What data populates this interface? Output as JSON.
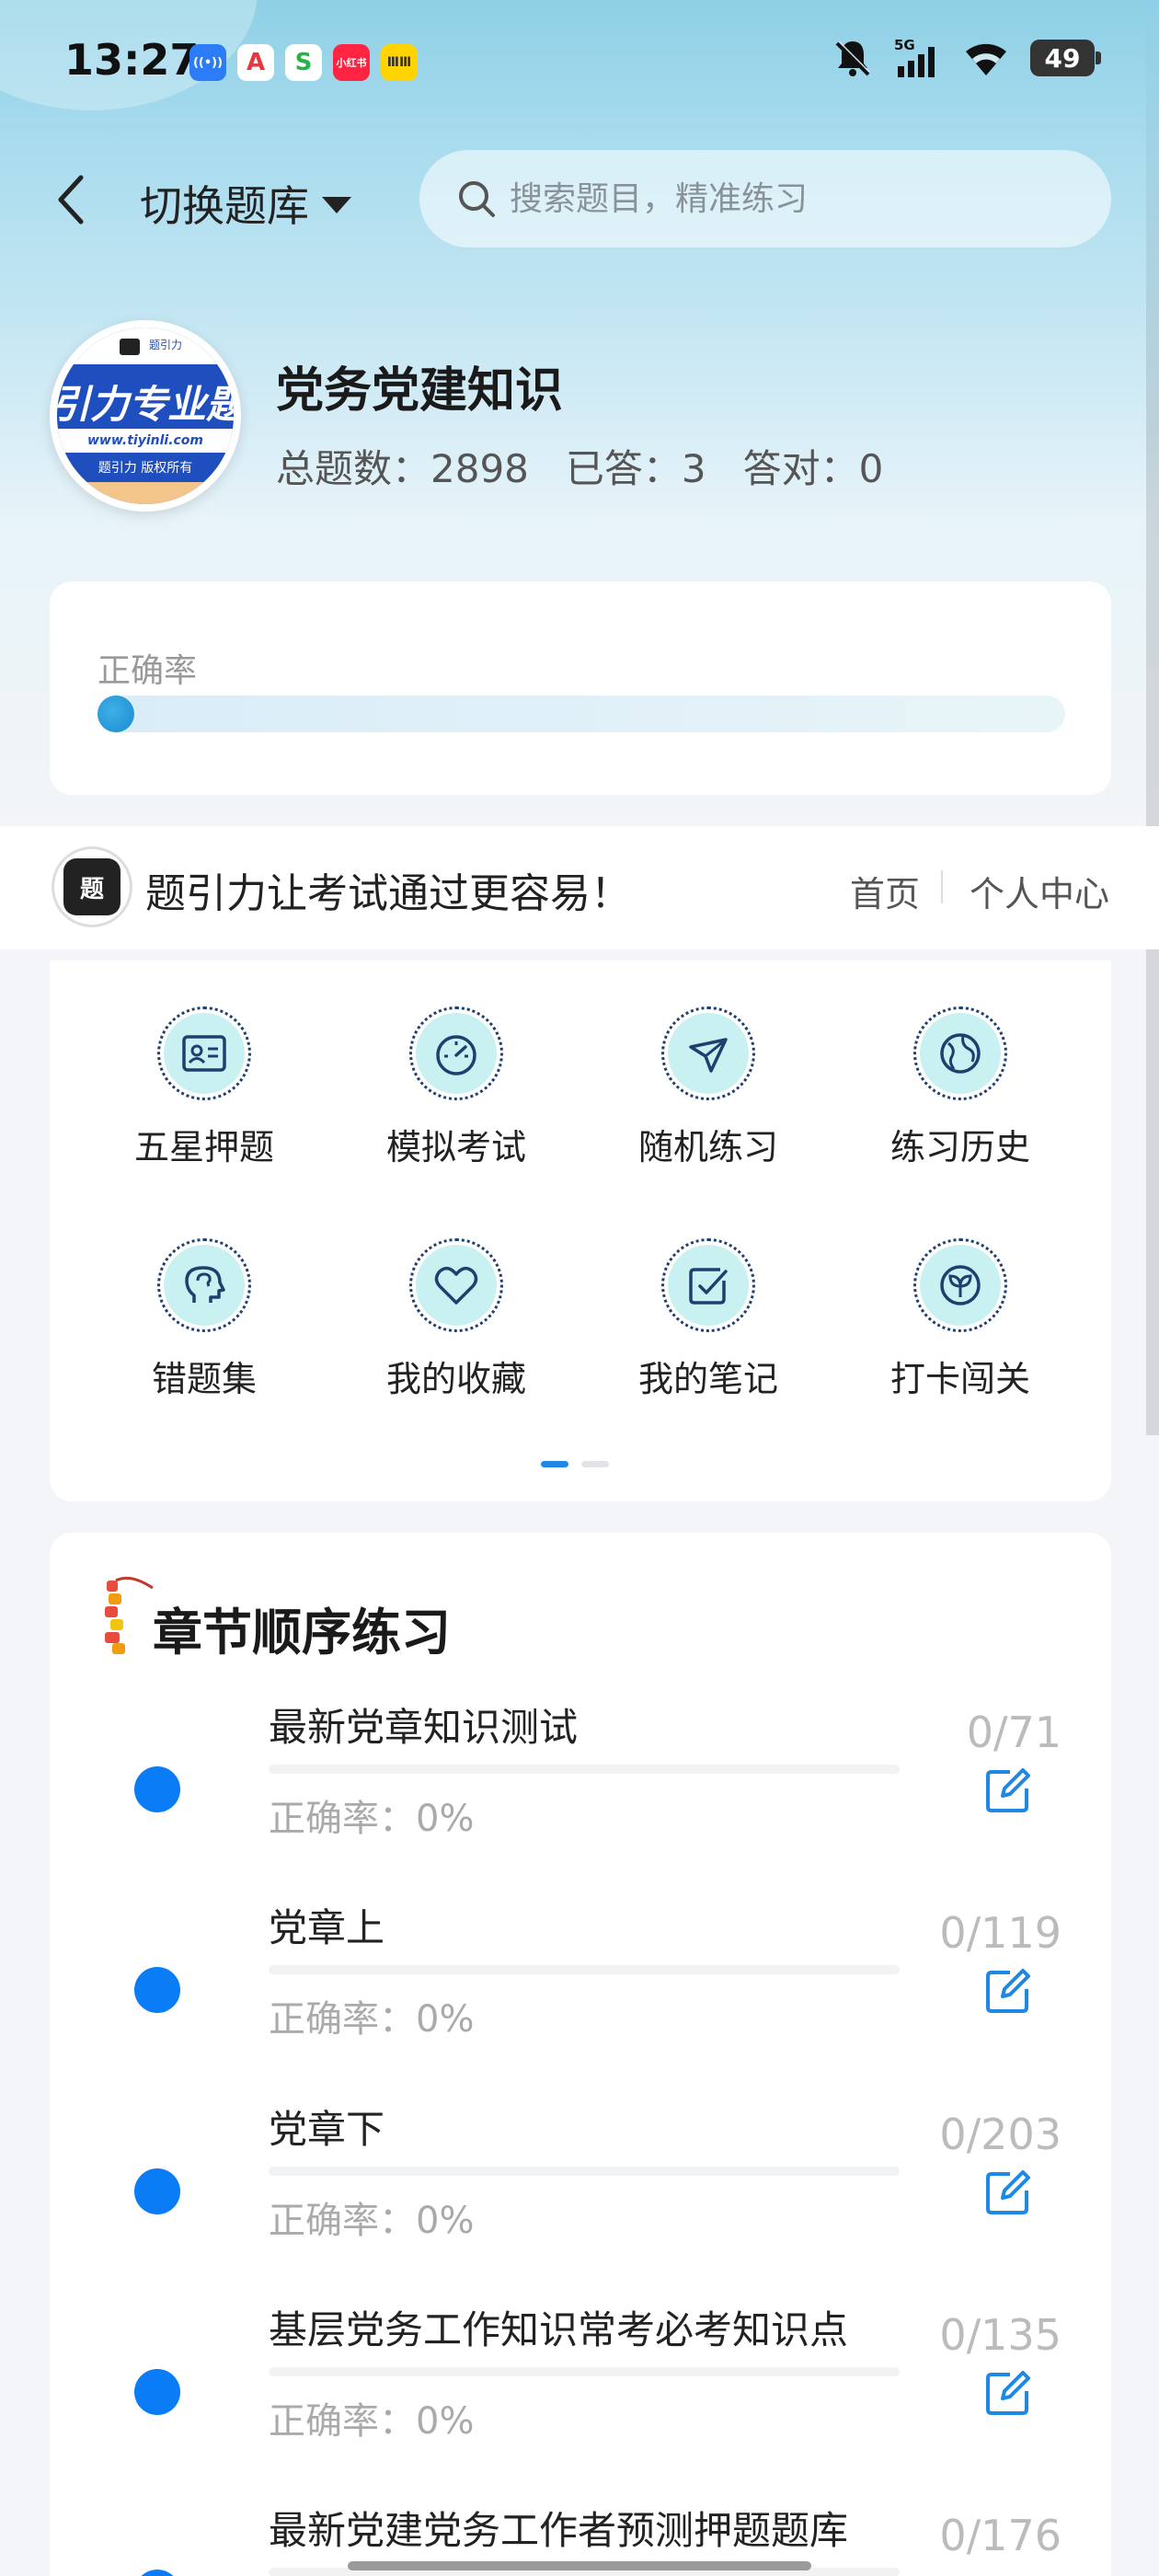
{
  "status_bar": {
    "time": "13:27",
    "network": "5G",
    "battery": "49",
    "app_icons": [
      {
        "name": "broadcast-app-icon",
        "color": "#2b7cf6",
        "glyph": "((•))"
      },
      {
        "name": "a-app-icon",
        "color": "#e8363d",
        "glyph": "A"
      },
      {
        "name": "s-app-icon",
        "color": "#27b24a",
        "glyph": "S"
      },
      {
        "name": "xiaohongshu-app-icon",
        "color": "#ff2442",
        "glyph": "小红书"
      },
      {
        "name": "yellow-app-icon",
        "color": "#ffd400",
        "glyph": "ⅢⅢ"
      }
    ]
  },
  "header": {
    "switch_label": "切换题库",
    "search_placeholder": "搜索题目，精准练习"
  },
  "bank": {
    "logo": {
      "title": "引力专业题",
      "url": "www.tiyinli.com",
      "copyright": "题引力 版权所有"
    },
    "name": "党务党建知识",
    "total": "总题数：2898",
    "answered": "已答：3",
    "correct": "答对：0"
  },
  "accuracy": {
    "label": "正确率",
    "value": 0
  },
  "slogan_bar": {
    "logo_text": "题引力",
    "slogan": "题引力让考试通过更容易！",
    "home": "首页",
    "user_center": "个人中心"
  },
  "menu": {
    "items": [
      {
        "label": "五星押题",
        "icon": "id-card-icon"
      },
      {
        "label": "模拟考试",
        "icon": "speedometer-icon"
      },
      {
        "label": "随机练习",
        "icon": "shuffle-compass-icon"
      },
      {
        "label": "练习历史",
        "icon": "globe-icon"
      },
      {
        "label": "错题集",
        "icon": "head-brain-icon"
      },
      {
        "label": "我的收藏",
        "icon": "heart-icon"
      },
      {
        "label": "我的笔记",
        "icon": "note-check-icon"
      },
      {
        "label": "打卡闯关",
        "icon": "sprout-icon"
      }
    ],
    "page": 1,
    "pages": 2
  },
  "chapters": {
    "title": "章节顺序练习",
    "items": [
      {
        "name": "最新党章知识测试",
        "accuracy": "正确率：0%",
        "count": "0/71"
      },
      {
        "name": "党章上",
        "accuracy": "正确率：0%",
        "count": "0/119"
      },
      {
        "name": "党章下",
        "accuracy": "正确率：0%",
        "count": "0/203"
      },
      {
        "name": "基层党务工作知识常考必考知识点",
        "accuracy": "正确率：0%",
        "count": "0/135"
      },
      {
        "name": "最新党建党务工作者预测押题题库",
        "accuracy": "",
        "count": "0/176"
      }
    ]
  },
  "colors": {
    "accent": "#0a7cf5",
    "icon_fill": "#c9f1f2",
    "icon_stroke": "#1f3f6f"
  }
}
